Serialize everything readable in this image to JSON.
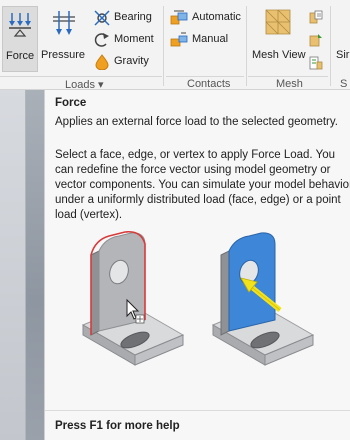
{
  "ribbon": {
    "loads": {
      "force_label": "Force",
      "pressure_label": "Pressure",
      "bearing_label": "Bearing",
      "moment_label": "Moment",
      "gravity_label": "Gravity",
      "panel_label": "Loads ▾"
    },
    "contacts": {
      "automatic_label": "Automatic",
      "manual_label": "Manual",
      "panel_label": "Contacts"
    },
    "mesh": {
      "mesh_view_label": "Mesh View",
      "panel_label": "Mesh",
      "partial_button_label": "Sir",
      "partial_panel_label": "S"
    }
  },
  "tooltip": {
    "title": "Force",
    "summary": "Applies an external force load to the selected geometry.",
    "detail": "Select a face, edge, or vertex to apply Force Load. You can redefine the force vector using model geometry or vector components. You can simulate your model behavior under a uniformly distributed load (face, edge) or a point load (vertex).",
    "footer": "Press F1 for more help"
  },
  "colors": {
    "highlight_face": "#3d86d8",
    "selection_edge": "#d83a3a",
    "force_arrow": "#f2e21c",
    "ribbon_bg": "#f3f3f3",
    "tooltip_bg": "#f7f7f7"
  }
}
